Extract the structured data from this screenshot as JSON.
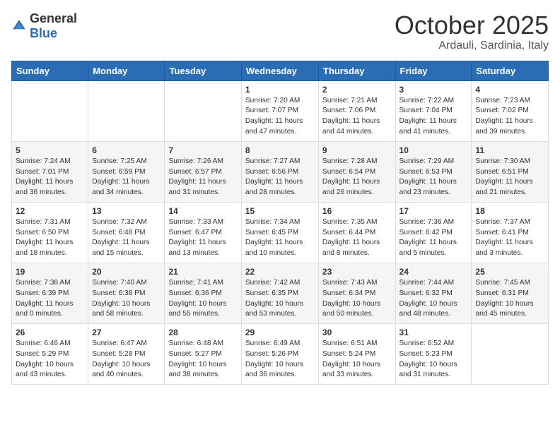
{
  "logo": {
    "general": "General",
    "blue": "Blue"
  },
  "header": {
    "month": "October 2025",
    "location": "Ardauli, Sardinia, Italy"
  },
  "days": [
    "Sunday",
    "Monday",
    "Tuesday",
    "Wednesday",
    "Thursday",
    "Friday",
    "Saturday"
  ],
  "weeks": [
    [
      {
        "num": "",
        "sunrise": "",
        "sunset": "",
        "daylight": ""
      },
      {
        "num": "",
        "sunrise": "",
        "sunset": "",
        "daylight": ""
      },
      {
        "num": "",
        "sunrise": "",
        "sunset": "",
        "daylight": ""
      },
      {
        "num": "1",
        "sunrise": "Sunrise: 7:20 AM",
        "sunset": "Sunset: 7:07 PM",
        "daylight": "Daylight: 11 hours and 47 minutes."
      },
      {
        "num": "2",
        "sunrise": "Sunrise: 7:21 AM",
        "sunset": "Sunset: 7:06 PM",
        "daylight": "Daylight: 11 hours and 44 minutes."
      },
      {
        "num": "3",
        "sunrise": "Sunrise: 7:22 AM",
        "sunset": "Sunset: 7:04 PM",
        "daylight": "Daylight: 11 hours and 41 minutes."
      },
      {
        "num": "4",
        "sunrise": "Sunrise: 7:23 AM",
        "sunset": "Sunset: 7:02 PM",
        "daylight": "Daylight: 11 hours and 39 minutes."
      }
    ],
    [
      {
        "num": "5",
        "sunrise": "Sunrise: 7:24 AM",
        "sunset": "Sunset: 7:01 PM",
        "daylight": "Daylight: 11 hours and 36 minutes."
      },
      {
        "num": "6",
        "sunrise": "Sunrise: 7:25 AM",
        "sunset": "Sunset: 6:59 PM",
        "daylight": "Daylight: 11 hours and 34 minutes."
      },
      {
        "num": "7",
        "sunrise": "Sunrise: 7:26 AM",
        "sunset": "Sunset: 6:57 PM",
        "daylight": "Daylight: 11 hours and 31 minutes."
      },
      {
        "num": "8",
        "sunrise": "Sunrise: 7:27 AM",
        "sunset": "Sunset: 6:56 PM",
        "daylight": "Daylight: 11 hours and 28 minutes."
      },
      {
        "num": "9",
        "sunrise": "Sunrise: 7:28 AM",
        "sunset": "Sunset: 6:54 PM",
        "daylight": "Daylight: 11 hours and 26 minutes."
      },
      {
        "num": "10",
        "sunrise": "Sunrise: 7:29 AM",
        "sunset": "Sunset: 6:53 PM",
        "daylight": "Daylight: 11 hours and 23 minutes."
      },
      {
        "num": "11",
        "sunrise": "Sunrise: 7:30 AM",
        "sunset": "Sunset: 6:51 PM",
        "daylight": "Daylight: 11 hours and 21 minutes."
      }
    ],
    [
      {
        "num": "12",
        "sunrise": "Sunrise: 7:31 AM",
        "sunset": "Sunset: 6:50 PM",
        "daylight": "Daylight: 11 hours and 18 minutes."
      },
      {
        "num": "13",
        "sunrise": "Sunrise: 7:32 AM",
        "sunset": "Sunset: 6:48 PM",
        "daylight": "Daylight: 11 hours and 15 minutes."
      },
      {
        "num": "14",
        "sunrise": "Sunrise: 7:33 AM",
        "sunset": "Sunset: 6:47 PM",
        "daylight": "Daylight: 11 hours and 13 minutes."
      },
      {
        "num": "15",
        "sunrise": "Sunrise: 7:34 AM",
        "sunset": "Sunset: 6:45 PM",
        "daylight": "Daylight: 11 hours and 10 minutes."
      },
      {
        "num": "16",
        "sunrise": "Sunrise: 7:35 AM",
        "sunset": "Sunset: 6:44 PM",
        "daylight": "Daylight: 11 hours and 8 minutes."
      },
      {
        "num": "17",
        "sunrise": "Sunrise: 7:36 AM",
        "sunset": "Sunset: 6:42 PM",
        "daylight": "Daylight: 11 hours and 5 minutes."
      },
      {
        "num": "18",
        "sunrise": "Sunrise: 7:37 AM",
        "sunset": "Sunset: 6:41 PM",
        "daylight": "Daylight: 11 hours and 3 minutes."
      }
    ],
    [
      {
        "num": "19",
        "sunrise": "Sunrise: 7:38 AM",
        "sunset": "Sunset: 6:39 PM",
        "daylight": "Daylight: 11 hours and 0 minutes."
      },
      {
        "num": "20",
        "sunrise": "Sunrise: 7:40 AM",
        "sunset": "Sunset: 6:38 PM",
        "daylight": "Daylight: 10 hours and 58 minutes."
      },
      {
        "num": "21",
        "sunrise": "Sunrise: 7:41 AM",
        "sunset": "Sunset: 6:36 PM",
        "daylight": "Daylight: 10 hours and 55 minutes."
      },
      {
        "num": "22",
        "sunrise": "Sunrise: 7:42 AM",
        "sunset": "Sunset: 6:35 PM",
        "daylight": "Daylight: 10 hours and 53 minutes."
      },
      {
        "num": "23",
        "sunrise": "Sunrise: 7:43 AM",
        "sunset": "Sunset: 6:34 PM",
        "daylight": "Daylight: 10 hours and 50 minutes."
      },
      {
        "num": "24",
        "sunrise": "Sunrise: 7:44 AM",
        "sunset": "Sunset: 6:32 PM",
        "daylight": "Daylight: 10 hours and 48 minutes."
      },
      {
        "num": "25",
        "sunrise": "Sunrise: 7:45 AM",
        "sunset": "Sunset: 6:31 PM",
        "daylight": "Daylight: 10 hours and 45 minutes."
      }
    ],
    [
      {
        "num": "26",
        "sunrise": "Sunrise: 6:46 AM",
        "sunset": "Sunset: 5:29 PM",
        "daylight": "Daylight: 10 hours and 43 minutes."
      },
      {
        "num": "27",
        "sunrise": "Sunrise: 6:47 AM",
        "sunset": "Sunset: 5:28 PM",
        "daylight": "Daylight: 10 hours and 40 minutes."
      },
      {
        "num": "28",
        "sunrise": "Sunrise: 6:48 AM",
        "sunset": "Sunset: 5:27 PM",
        "daylight": "Daylight: 10 hours and 38 minutes."
      },
      {
        "num": "29",
        "sunrise": "Sunrise: 6:49 AM",
        "sunset": "Sunset: 5:26 PM",
        "daylight": "Daylight: 10 hours and 36 minutes."
      },
      {
        "num": "30",
        "sunrise": "Sunrise: 6:51 AM",
        "sunset": "Sunset: 5:24 PM",
        "daylight": "Daylight: 10 hours and 33 minutes."
      },
      {
        "num": "31",
        "sunrise": "Sunrise: 6:52 AM",
        "sunset": "Sunset: 5:23 PM",
        "daylight": "Daylight: 10 hours and 31 minutes."
      },
      {
        "num": "",
        "sunrise": "",
        "sunset": "",
        "daylight": ""
      }
    ]
  ]
}
